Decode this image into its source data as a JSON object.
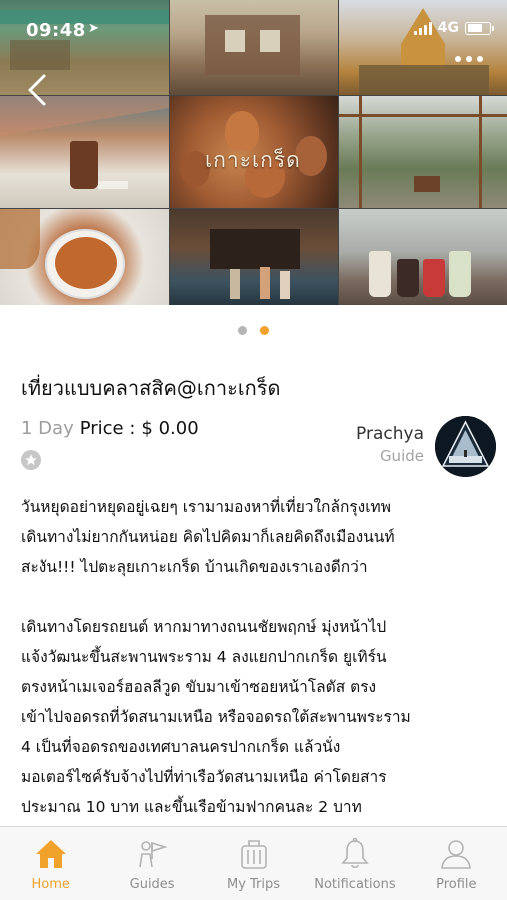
{
  "status_bar": {
    "time": "09:48",
    "network": "4G"
  },
  "hero": {
    "logo_text": "เกาะเกร็ด",
    "slides": 2,
    "active_slide": 2
  },
  "trip": {
    "title": "เที่ยวแบบคลาสสิค@เกาะเกร็ด",
    "duration": "1 Day",
    "price_label": "Price :",
    "price_value": "$ 0.00"
  },
  "guide": {
    "name": "Prachya",
    "role": "Guide"
  },
  "description": {
    "paragraph_1": "วันหยุดอย่าหยุดอยู่เฉยๆ เรามามองหาที่เที่ยวใกล้กรุงเทพ\nเดินทางไม่ยากกันหน่อย คิดไปคิดมาก็เลยคิดถึงเมืองนนท์\nสะงัน!!! ไปตะลุยเกาะเกร็ด บ้านเกิดของเราเองดีกว่า",
    "paragraph_2": "เดินทางโดยรถยนต์ หากมาทางถนนชัยพฤกษ์ มุ่งหน้าไป\nแจ้งวัฒนะขึ้นสะพานพระราม 4 ลงแยกปากเกร็ด ยูเทิร์น\nตรงหน้าเมเจอร์ฮอลลีวูด ขับมาเข้าซอยหน้าโลตัส ตรง\nเข้าไปจอดรถที่วัดสนามเหนือ หรือจอดรถใต้สะพานพระราม\n4 เป็นที่จอดรถของเทศบาลนครปากเกร็ด แล้วนั่ง\nมอเตอร์ไซค์รับจ้างไปที่ท่าเรือวัดสนามเหนือ ค่าโดยสาร\nประมาณ 10 บาท และขึ้นเรือข้ามฟากคนละ 2 บาท"
  },
  "tabs": [
    {
      "label": "Home",
      "icon": "home-icon",
      "active": true
    },
    {
      "label": "Guides",
      "icon": "guide-flag-icon",
      "active": false
    },
    {
      "label": "My Trips",
      "icon": "luggage-icon",
      "active": false
    },
    {
      "label": "Notifications",
      "icon": "bell-icon",
      "active": false
    },
    {
      "label": "Profile",
      "icon": "user-icon",
      "active": false
    }
  ],
  "colors": {
    "accent": "#f0a22a",
    "inactive_icon": "#b3b3b3",
    "muted_text": "#9d9d9d"
  }
}
